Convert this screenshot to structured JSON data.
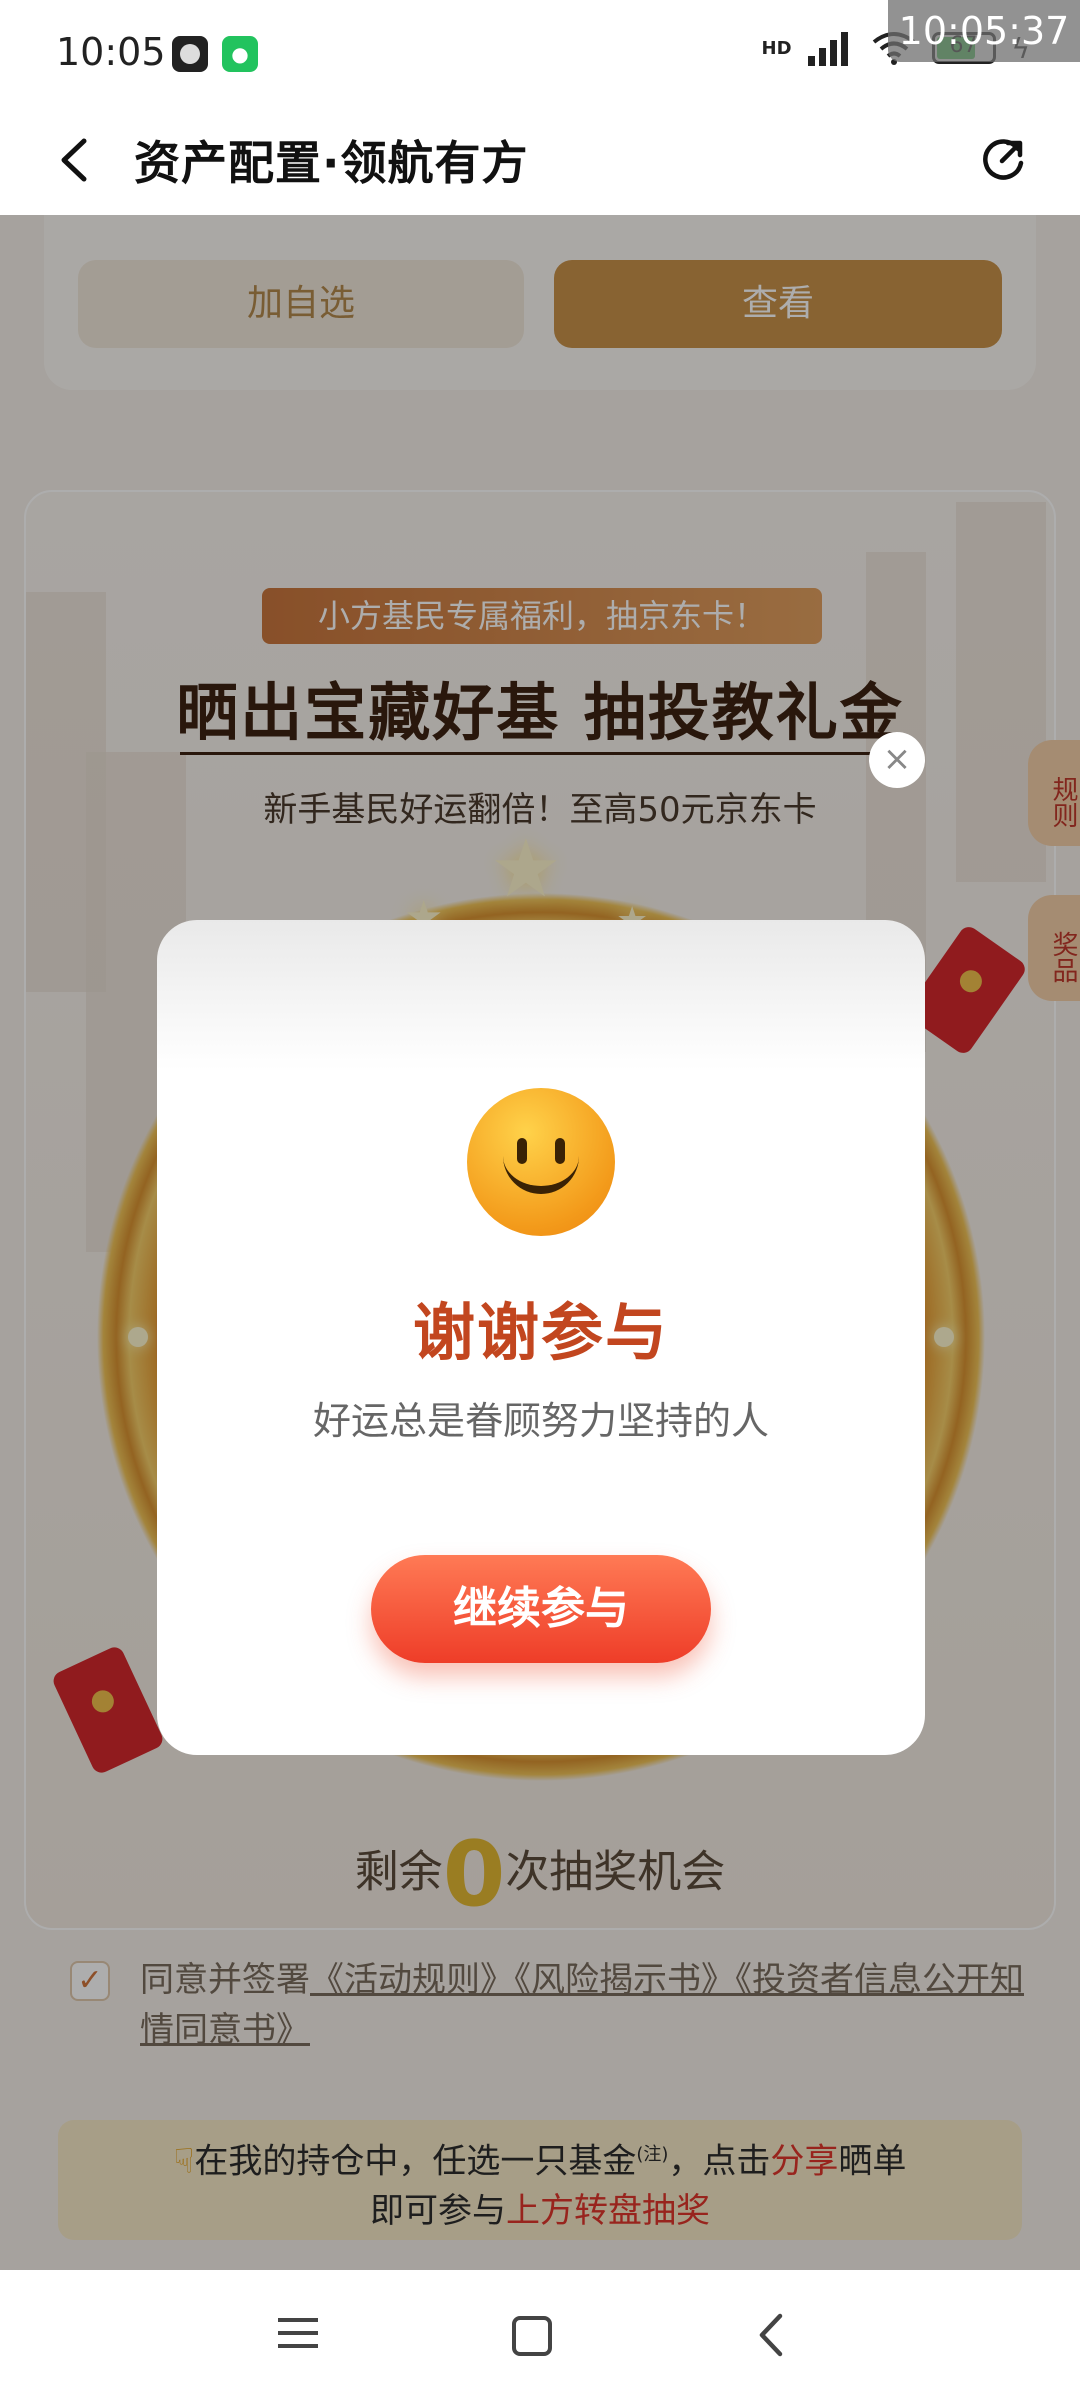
{
  "status_bar": {
    "time": "10:05",
    "network": "HD",
    "battery": "67",
    "clock_overlay": "10:05:37"
  },
  "nav": {
    "title": "资产配置·领航有方"
  },
  "top_card": {
    "add_label": "加自选",
    "view_label": "查看"
  },
  "promo": {
    "tag": "小方基民专属福利，抽京东卡！",
    "title": "晒出宝藏好基  抽投教礼金",
    "subtitle": "新手基民好运翻倍！至高50元京东卡",
    "remaining_prefix": "剩余",
    "remaining_count": "0",
    "remaining_suffix": "次抽奖机会"
  },
  "side_tabs": {
    "rules": "规则",
    "prizes": "奖品"
  },
  "agreement": {
    "prefix": "同意并签署",
    "doc1": "《活动规则》",
    "doc2": "《风险揭示书》",
    "doc3": "《投资者信息公开知情同意书》"
  },
  "hint": {
    "line1_a": "在我的持仓中，任选一只基金",
    "note": "(注)",
    "line1_b": "，点击",
    "share": "分享",
    "line1_c": "晒单",
    "line2_a": "即可参与",
    "line2_b": "上方转盘抽奖"
  },
  "modal": {
    "title": "谢谢参与",
    "subtitle": "好运总是眷顾努力坚持的人",
    "button": "继续参与",
    "close": "×"
  },
  "colors": {
    "accent_gold": "#c9924a",
    "modal_button": "#ee3d28",
    "modal_title": "#c2461f"
  }
}
